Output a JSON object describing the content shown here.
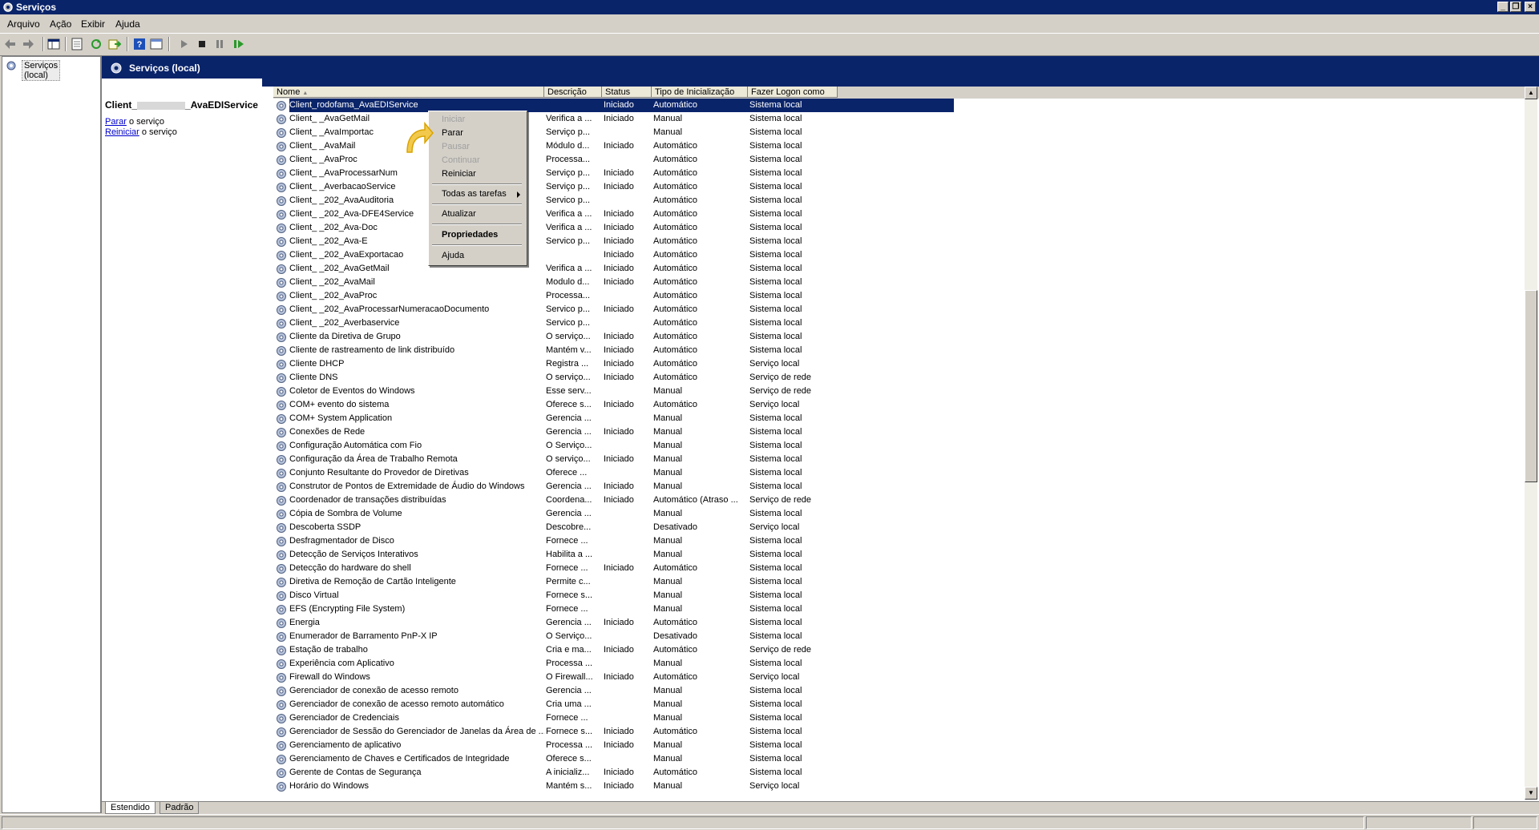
{
  "window": {
    "title": "Serviços"
  },
  "menubar": [
    "Arquivo",
    "Ação",
    "Exibir",
    "Ajuda"
  ],
  "tree": {
    "root_label": "Serviços (local)"
  },
  "panel": {
    "header_title": "Serviços (local)",
    "selected_service_prefix": "Client_",
    "selected_service_suffix": "_AvaEDIService",
    "actions": [
      {
        "link": "Parar",
        "rest": " o serviço"
      },
      {
        "link": "Reiniciar",
        "rest": " o serviço"
      }
    ]
  },
  "columns": [
    "Nome",
    "Descrição",
    "Status",
    "Tipo de Inicialização",
    "Fazer Logon como"
  ],
  "rows": [
    [
      "Client_rodofama_AvaEDIService",
      "",
      "Iniciado",
      "Automático",
      "Sistema local"
    ],
    [
      "Client_ _AvaGetMail",
      "Verifica a ...",
      "Iniciado",
      "Manual",
      "Sistema local"
    ],
    [
      "Client_ _AvaImportac",
      "Serviço p...",
      "",
      "Manual",
      "Sistema local"
    ],
    [
      "Client_ _AvaMail",
      "Módulo d...",
      "Iniciado",
      "Automático",
      "Sistema local"
    ],
    [
      "Client_ _AvaProc",
      "Processa...",
      "",
      "Automático",
      "Sistema local"
    ],
    [
      "Client_ _AvaProcessarNum",
      "Serviço p...",
      "Iniciado",
      "Automático",
      "Sistema local"
    ],
    [
      "Client_ _AverbacaoService",
      "Serviço p...",
      "Iniciado",
      "Automático",
      "Sistema local"
    ],
    [
      "Client_ _202_AvaAuditoria",
      "Servico p...",
      "",
      "Automático",
      "Sistema local"
    ],
    [
      "Client_ _202_Ava-DFE4Service",
      "Verifica a ...",
      "Iniciado",
      "Automático",
      "Sistema local"
    ],
    [
      "Client_ _202_Ava-Doc",
      "Verifica a ...",
      "Iniciado",
      "Automático",
      "Sistema local"
    ],
    [
      "Client_ _202_Ava-E",
      "Servico p...",
      "Iniciado",
      "Automático",
      "Sistema local"
    ],
    [
      "Client_ _202_AvaExportacao",
      "",
      "Iniciado",
      "Automático",
      "Sistema local"
    ],
    [
      "Client_ _202_AvaGetMail",
      "Verifica a ...",
      "Iniciado",
      "Automático",
      "Sistema local"
    ],
    [
      "Client_ _202_AvaMail",
      "Modulo d...",
      "Iniciado",
      "Automático",
      "Sistema local"
    ],
    [
      "Client_ _202_AvaProc",
      "Processa...",
      "",
      "Automático",
      "Sistema local"
    ],
    [
      "Client_ _202_AvaProcessarNumeracaoDocumento",
      "Servico p...",
      "Iniciado",
      "Automático",
      "Sistema local"
    ],
    [
      "Client_ _202_Averbaservice",
      "Servico p...",
      "",
      "Automático",
      "Sistema local"
    ],
    [
      "Cliente da Diretiva de Grupo",
      "O serviço...",
      "Iniciado",
      "Automático",
      "Sistema local"
    ],
    [
      "Cliente de rastreamento de link distribuído",
      "Mantém v...",
      "Iniciado",
      "Automático",
      "Sistema local"
    ],
    [
      "Cliente DHCP",
      "Registra ...",
      "Iniciado",
      "Automático",
      "Serviço local"
    ],
    [
      "Cliente DNS",
      "O serviço...",
      "Iniciado",
      "Automático",
      "Serviço de rede"
    ],
    [
      "Coletor de Eventos do Windows",
      "Esse serv...",
      "",
      "Manual",
      "Serviço de rede"
    ],
    [
      "COM+ evento do sistema",
      "Oferece s...",
      "Iniciado",
      "Automático",
      "Serviço local"
    ],
    [
      "COM+ System Application",
      "Gerencia ...",
      "",
      "Manual",
      "Sistema local"
    ],
    [
      "Conexões de Rede",
      "Gerencia ...",
      "Iniciado",
      "Manual",
      "Sistema local"
    ],
    [
      "Configuração Automática com Fio",
      "O Serviço...",
      "",
      "Manual",
      "Sistema local"
    ],
    [
      "Configuração da Área de Trabalho Remota",
      "O serviço...",
      "Iniciado",
      "Manual",
      "Sistema local"
    ],
    [
      "Conjunto Resultante do Provedor de Diretivas",
      "Oferece ...",
      "",
      "Manual",
      "Sistema local"
    ],
    [
      "Construtor de Pontos de Extremidade de Áudio do Windows",
      "Gerencia ...",
      "Iniciado",
      "Manual",
      "Sistema local"
    ],
    [
      "Coordenador de transações distribuídas",
      "Coordena...",
      "Iniciado",
      "Automático (Atraso ...",
      "Serviço de rede"
    ],
    [
      "Cópia de Sombra de Volume",
      "Gerencia ...",
      "",
      "Manual",
      "Sistema local"
    ],
    [
      "Descoberta SSDP",
      "Descobre...",
      "",
      "Desativado",
      "Serviço local"
    ],
    [
      "Desfragmentador de Disco",
      "Fornece ...",
      "",
      "Manual",
      "Sistema local"
    ],
    [
      "Detecção de Serviços Interativos",
      "Habilita a ...",
      "",
      "Manual",
      "Sistema local"
    ],
    [
      "Detecção do hardware do shell",
      "Fornece ...",
      "Iniciado",
      "Automático",
      "Sistema local"
    ],
    [
      "Diretiva de Remoção de Cartão Inteligente",
      "Permite c...",
      "",
      "Manual",
      "Sistema local"
    ],
    [
      "Disco Virtual",
      "Fornece s...",
      "",
      "Manual",
      "Sistema local"
    ],
    [
      "EFS (Encrypting File System)",
      "Fornece ...",
      "",
      "Manual",
      "Sistema local"
    ],
    [
      "Energia",
      "Gerencia ...",
      "Iniciado",
      "Automático",
      "Sistema local"
    ],
    [
      "Enumerador de Barramento PnP-X IP",
      "O Serviço...",
      "",
      "Desativado",
      "Sistema local"
    ],
    [
      "Estação de trabalho",
      "Cria e ma...",
      "Iniciado",
      "Automático",
      "Serviço de rede"
    ],
    [
      "Experiência com Aplicativo",
      "Processa ...",
      "",
      "Manual",
      "Sistema local"
    ],
    [
      "Firewall do Windows",
      "O Firewall...",
      "Iniciado",
      "Automático",
      "Serviço local"
    ],
    [
      "Gerenciador de conexão de acesso remoto",
      "Gerencia ...",
      "",
      "Manual",
      "Sistema local"
    ],
    [
      "Gerenciador de conexão de acesso remoto automático",
      "Cria uma ...",
      "",
      "Manual",
      "Sistema local"
    ],
    [
      "Gerenciador de Credenciais",
      "Fornece ...",
      "",
      "Manual",
      "Sistema local"
    ],
    [
      "Gerenciador de Sessão do Gerenciador de Janelas da Área de ...",
      "Fornece s...",
      "Iniciado",
      "Automático",
      "Sistema local"
    ],
    [
      "Gerenciamento de aplicativo",
      "Processa ...",
      "Iniciado",
      "Manual",
      "Sistema local"
    ],
    [
      "Gerenciamento de Chaves e Certificados de Integridade",
      "Oferece s...",
      "",
      "Manual",
      "Sistema local"
    ],
    [
      "Gerente de Contas de Segurança",
      "A inicializ...",
      "Iniciado",
      "Automático",
      "Sistema local"
    ],
    [
      "Horário do Windows",
      "Mantém s...",
      "Iniciado",
      "Manual",
      "Serviço local"
    ]
  ],
  "context_menu": [
    {
      "label": "Iniciar",
      "state": "disabled"
    },
    {
      "label": "Parar",
      "state": "enabled"
    },
    {
      "label": "Pausar",
      "state": "disabled"
    },
    {
      "label": "Continuar",
      "state": "disabled"
    },
    {
      "label": "Reiniciar",
      "state": "enabled"
    },
    {
      "label": "Todas as tarefas",
      "state": "submenu"
    },
    {
      "label": "Atualizar",
      "state": "enabled"
    },
    {
      "label": "Propriedades",
      "state": "bold"
    },
    {
      "label": "Ajuda",
      "state": "enabled"
    }
  ],
  "bottom_tabs": [
    "Estendido",
    "Padrão"
  ],
  "icons": {
    "title": "gear-icon",
    "toolbar": [
      "back-icon",
      "forward-icon",
      "show-tree-icon",
      "properties-icon",
      "refresh-icon",
      "export-icon",
      "help-icon",
      "console-icon",
      "play-icon",
      "stop-icon",
      "pause-icon",
      "resume-icon"
    ]
  },
  "colors": {
    "titlebar": "#0a246a",
    "selection": "#0a246a",
    "chrome": "#d4d0c8",
    "link": "#0000cc",
    "cursor_accent": "#f2c94c"
  }
}
